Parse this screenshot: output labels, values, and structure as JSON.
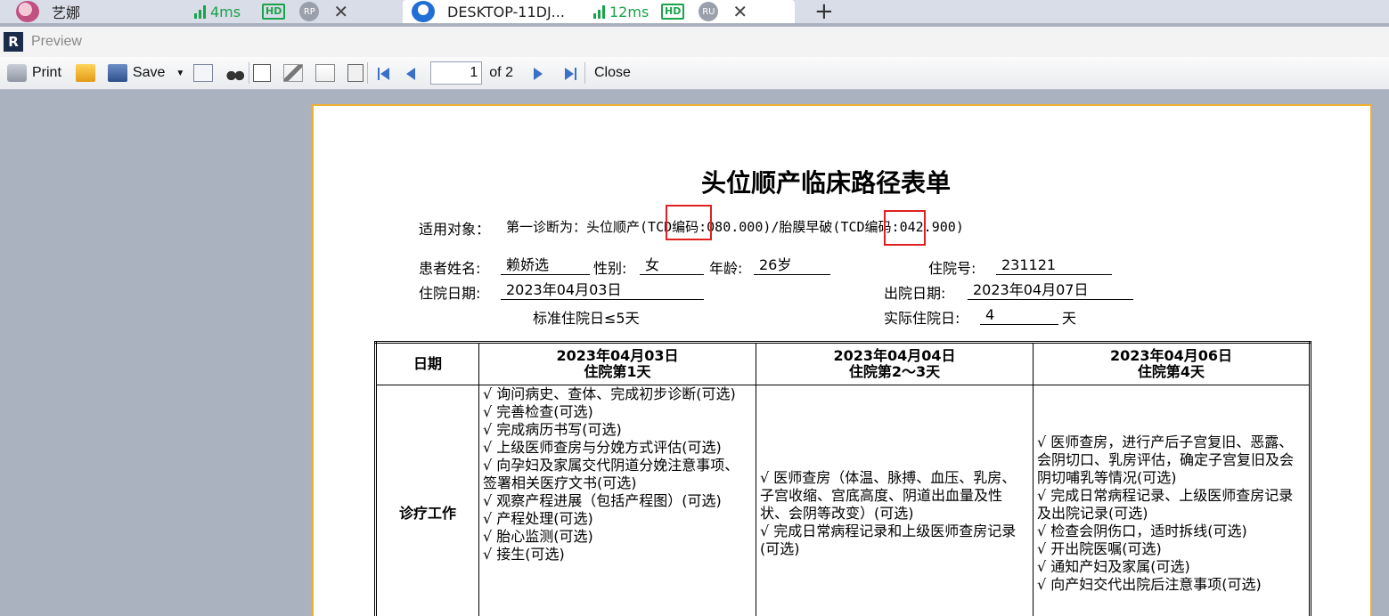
{
  "tabs": [
    {
      "name": "艺娜",
      "ping": "4ms",
      "hd": "HD",
      "badge": "RP"
    },
    {
      "name": "DESKTOP-11DJ...",
      "ping": "12ms",
      "hd": "HD",
      "badge": "RU"
    }
  ],
  "app": {
    "title": "Preview"
  },
  "toolbar": {
    "print_label": "Print",
    "save_label": "Save",
    "current_page": "1",
    "page_of": "of 2",
    "close_label": "Close"
  },
  "document": {
    "title": "头位顺产临床路径表单",
    "applies_label": "适用对象：",
    "applies_text": "第一诊断为：头位顺产(TCD编码:080.000)/胎膜早破(TCD编码:042.900)",
    "patient_name_label": "患者姓名:",
    "patient_name": "赖娇选",
    "sex_label": "性别:",
    "sex": "女",
    "age_label": "年龄:",
    "age": "26岁",
    "inpatient_no_label": "住院号:",
    "inpatient_no": "231121",
    "admit_date_label": "住院日期:",
    "admit_date": "2023年04月03日",
    "discharge_date_label": "出院日期:",
    "discharge_date": "2023年04月07日",
    "std_stay": "标准住院日≤5天",
    "actual_stay_label": "实际住院日:",
    "actual_stay": "4",
    "actual_stay_unit": "天",
    "table": {
      "date_header": "日期",
      "columns": [
        {
          "date": "2023年04月03日",
          "day": "住院第1天"
        },
        {
          "date": "2023年04月04日",
          "day": "住院第2～3天"
        },
        {
          "date": "2023年04月06日",
          "day": "住院第4天"
        }
      ],
      "row_label": "诊疗工作",
      "col1_items": [
        "√ 询问病史、查体、完成初步诊断(可选)",
        "√ 完善检查(可选)",
        "√ 完成病历书写(可选)",
        "√ 上级医师查房与分娩方式评估(可选)",
        "√ 向孕妇及家属交代阴道分娩注意事项、签署相关医疗文书(可选)",
        "√ 观察产程进展（包括产程图）(可选)",
        "√ 产程处理(可选)",
        "√   胎心监测(可选)",
        "√ 接生(可选)"
      ],
      "col2_items": [
        "√ 医师查房（体温、脉搏、血压、乳房、子宫收缩、宫底高度、阴道出血量及性状、会阴等改变）(可选)",
        "√   完成日常病程记录和上级医师查房记录(可选)"
      ],
      "col3_items": [
        "√ 医师查房，进行产后子宫复旧、恶露、会阴切口、乳房评估，确定子宫复旧及会阴切哺乳等情况(可选)",
        "√ 完成日常病程记录、上级医师查房记录及出院记录(可选)",
        "√ 检查会阴伤口，适时拆线(可选)",
        "√ 开出院医嘱(可选)",
        "√ 通知产妇及家属(可选)",
        "√ 向产妇交代出院后注意事项(可选)"
      ]
    }
  }
}
